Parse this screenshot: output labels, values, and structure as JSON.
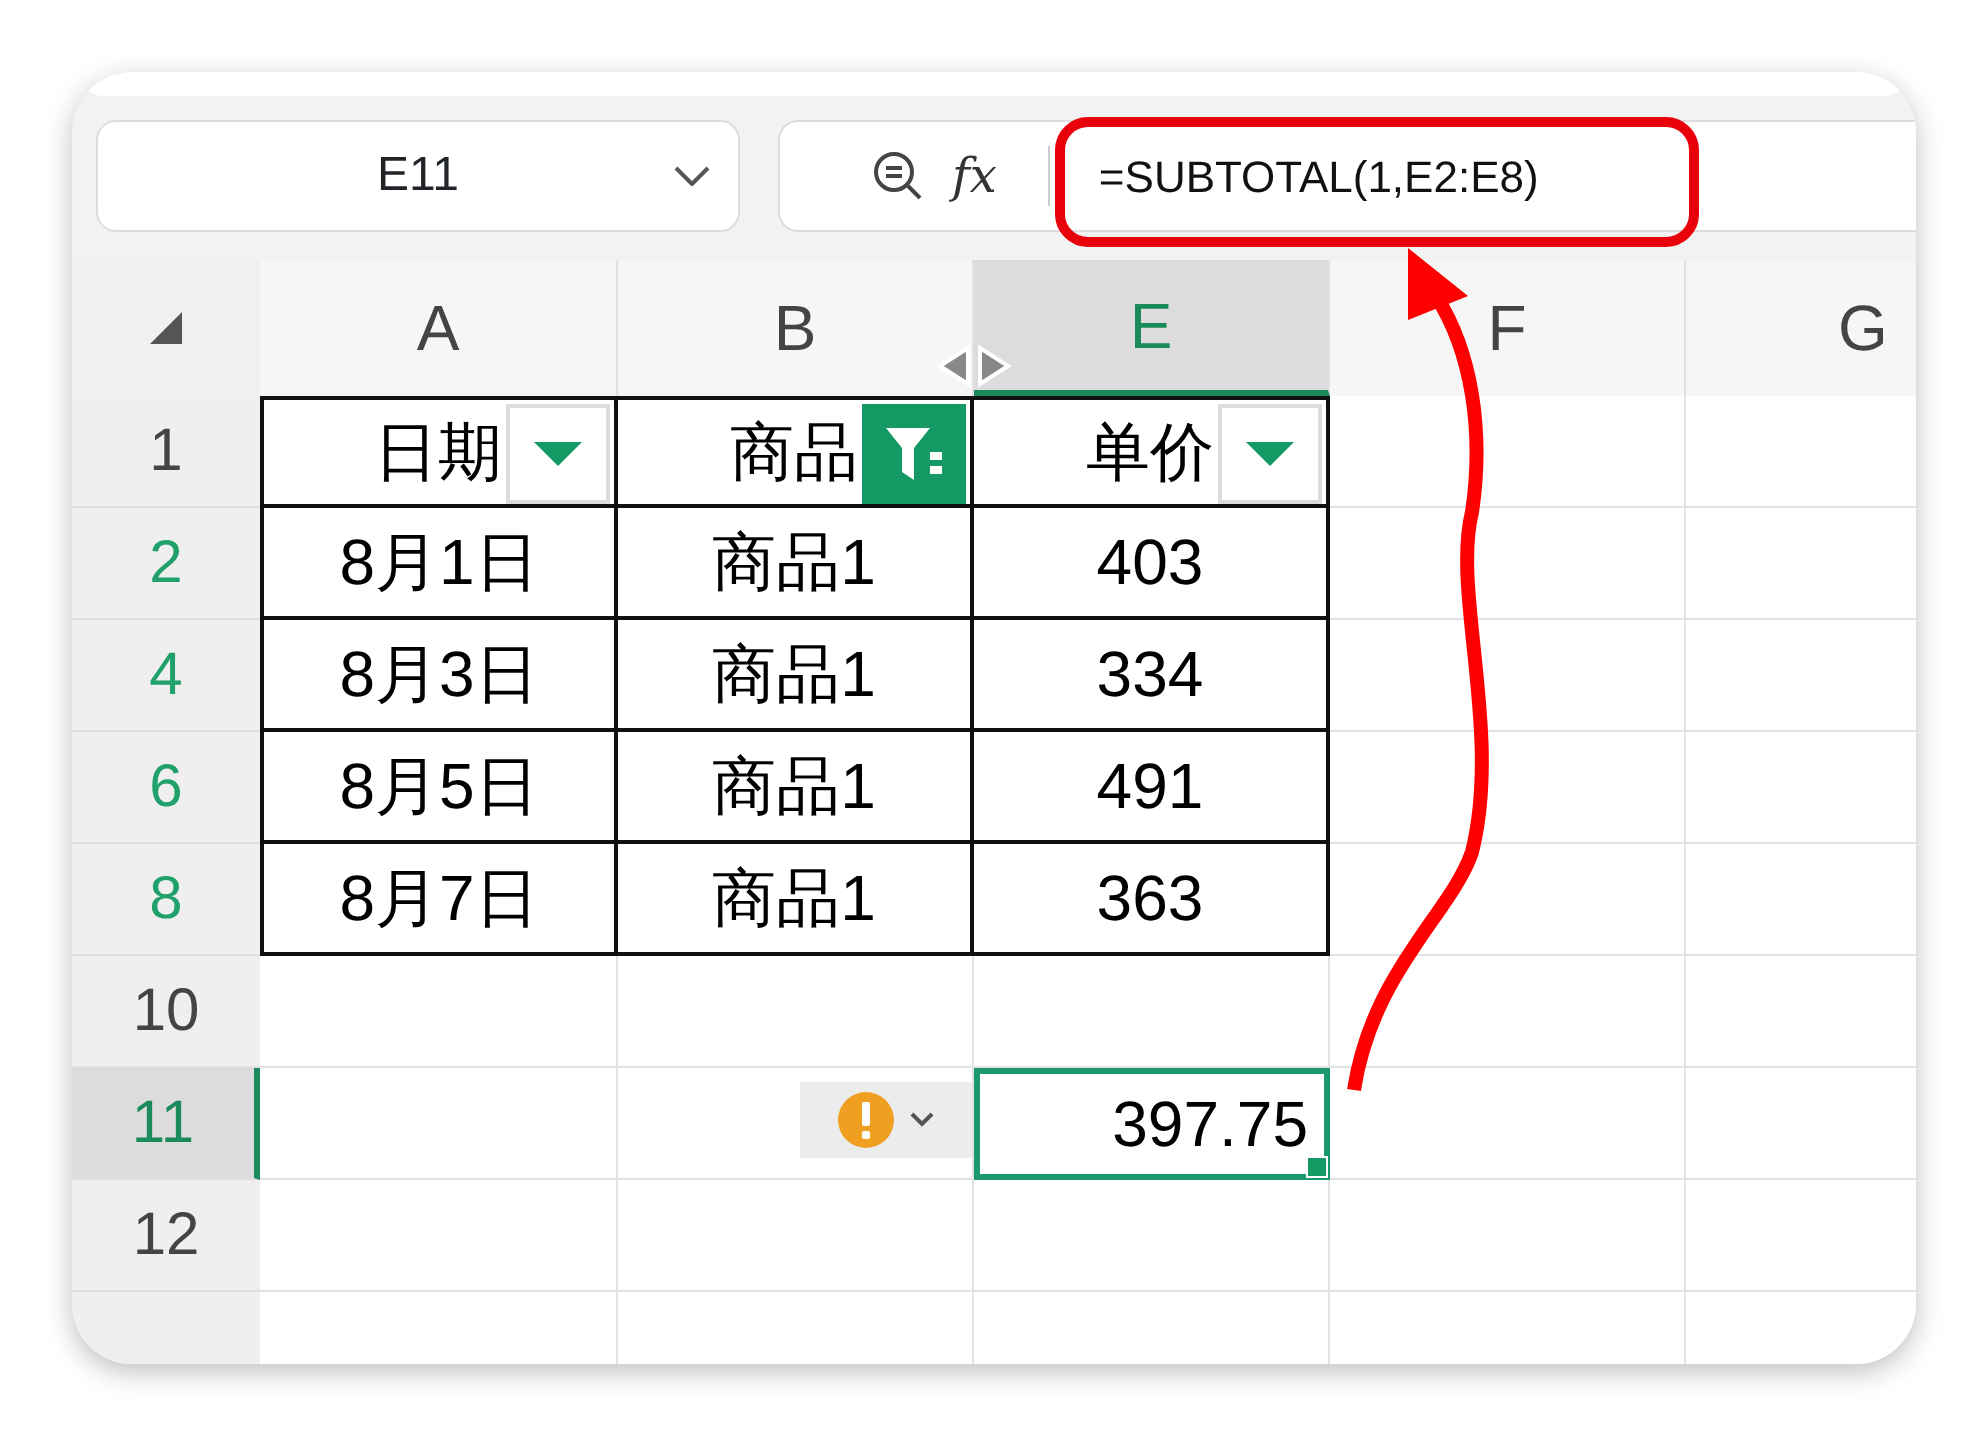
{
  "name_box": {
    "value": "E11"
  },
  "formula_bar": {
    "function_label": "fx",
    "formula": "=SUBTOTAL(1,E2:E8)",
    "highlighted": true
  },
  "columns": [
    {
      "label": "A",
      "selected": false
    },
    {
      "label": "B",
      "selected": false
    },
    {
      "label": "E",
      "selected": true
    },
    {
      "label": "F",
      "selected": false
    },
    {
      "label": "G",
      "selected": false
    }
  ],
  "rows": [
    {
      "header": "1",
      "filtered": false,
      "selected": false,
      "table": true,
      "cells": [
        {
          "text": "日期",
          "filter_applied": false
        },
        {
          "text": "商品",
          "filter_applied": true
        },
        {
          "text": "单价",
          "filter_applied": false
        },
        {},
        {}
      ]
    },
    {
      "header": "2",
      "filtered": true,
      "selected": false,
      "table": true,
      "cells": [
        {
          "text": "8月1日"
        },
        {
          "text": "商品1"
        },
        {
          "text": "403"
        },
        {},
        {}
      ]
    },
    {
      "header": "4",
      "filtered": true,
      "selected": false,
      "table": true,
      "cells": [
        {
          "text": "8月3日"
        },
        {
          "text": "商品1"
        },
        {
          "text": "334"
        },
        {},
        {}
      ]
    },
    {
      "header": "6",
      "filtered": true,
      "selected": false,
      "table": true,
      "cells": [
        {
          "text": "8月5日"
        },
        {
          "text": "商品1"
        },
        {
          "text": "491"
        },
        {},
        {}
      ]
    },
    {
      "header": "8",
      "filtered": true,
      "selected": false,
      "table": true,
      "cells": [
        {
          "text": "8月7日"
        },
        {
          "text": "商品1"
        },
        {
          "text": "363"
        },
        {},
        {}
      ]
    },
    {
      "header": "10",
      "filtered": false,
      "selected": false,
      "table": false,
      "cells": [
        {},
        {},
        {},
        {},
        {}
      ]
    },
    {
      "header": "11",
      "filtered": false,
      "selected": true,
      "table": false,
      "cells": [
        {},
        {
          "error_flag": true
        },
        {
          "text": "397.75",
          "right_aligned": true,
          "selected": true
        },
        {},
        {}
      ]
    },
    {
      "header": "12",
      "filtered": false,
      "selected": false,
      "table": false,
      "cells": [
        {},
        {},
        {},
        {},
        {}
      ]
    },
    {
      "table": false,
      "cells": [
        {},
        {},
        {},
        {},
        {}
      ]
    }
  ]
}
